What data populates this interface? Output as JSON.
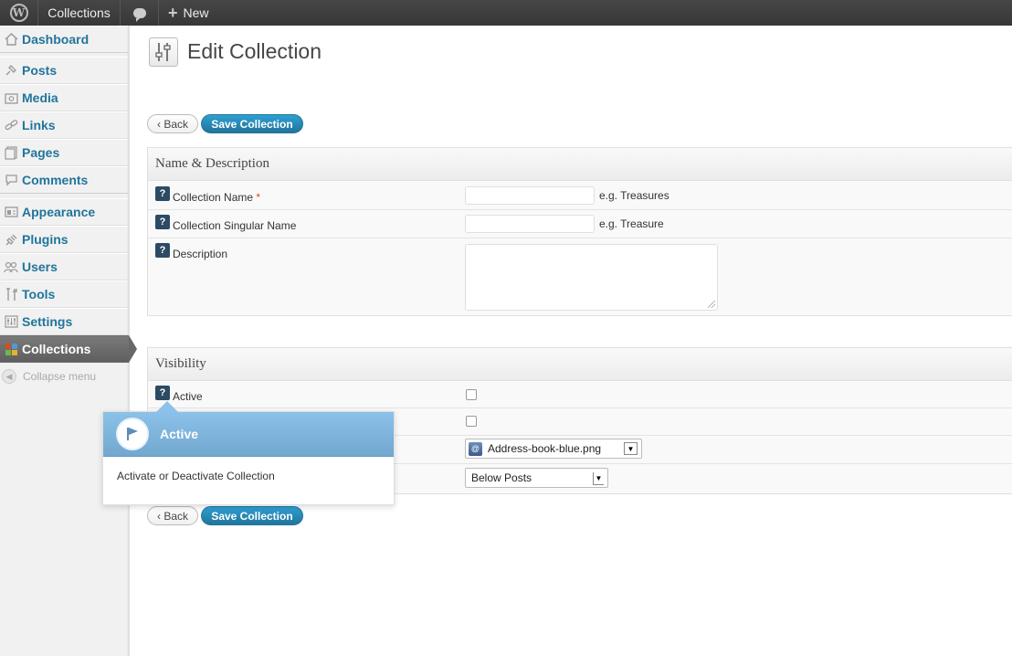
{
  "adminbar": {
    "site_name": "Collections",
    "new_label": "New"
  },
  "sidebar": {
    "items": [
      {
        "label": "Dashboard",
        "icon": "home-icon"
      },
      {
        "label": "Posts",
        "icon": "pin-icon"
      },
      {
        "label": "Media",
        "icon": "media-icon"
      },
      {
        "label": "Links",
        "icon": "link-icon"
      },
      {
        "label": "Pages",
        "icon": "pages-icon"
      },
      {
        "label": "Comments",
        "icon": "comment-icon"
      },
      {
        "label": "Appearance",
        "icon": "appearance-icon"
      },
      {
        "label": "Plugins",
        "icon": "plugin-icon"
      },
      {
        "label": "Users",
        "icon": "users-icon"
      },
      {
        "label": "Tools",
        "icon": "tools-icon"
      },
      {
        "label": "Settings",
        "icon": "settings-icon"
      },
      {
        "label": "Collections",
        "icon": "collections-icon"
      }
    ],
    "collapse_label": "Collapse menu"
  },
  "main": {
    "title": "Edit Collection",
    "back_label": "‹ Back",
    "save_label": "Save Collection",
    "sections": {
      "name_desc": {
        "heading": "Name & Description",
        "fields": {
          "collection_name": {
            "label": "Collection Name",
            "required_mark": "*",
            "value": "",
            "hint": "e.g. Treasures"
          },
          "singular_name": {
            "label": "Collection Singular Name",
            "value": "",
            "hint": "e.g. Treasure"
          },
          "description": {
            "label": "Description",
            "value": ""
          }
        }
      },
      "visibility": {
        "heading": "Visibility",
        "fields": {
          "active": {
            "label": "Active",
            "checked": false
          },
          "icon_select": {
            "value": "Address-book-blue.png"
          },
          "position_select": {
            "value": "Below Posts"
          }
        }
      }
    }
  },
  "pointer": {
    "title": "Active",
    "body": "Activate or Deactivate Collection"
  },
  "colors": {
    "link_blue": "#21759b",
    "help_icon_bg": "#2c4a64",
    "pointer_header": "#72a7cf",
    "adminbar_bg": "#464646"
  }
}
